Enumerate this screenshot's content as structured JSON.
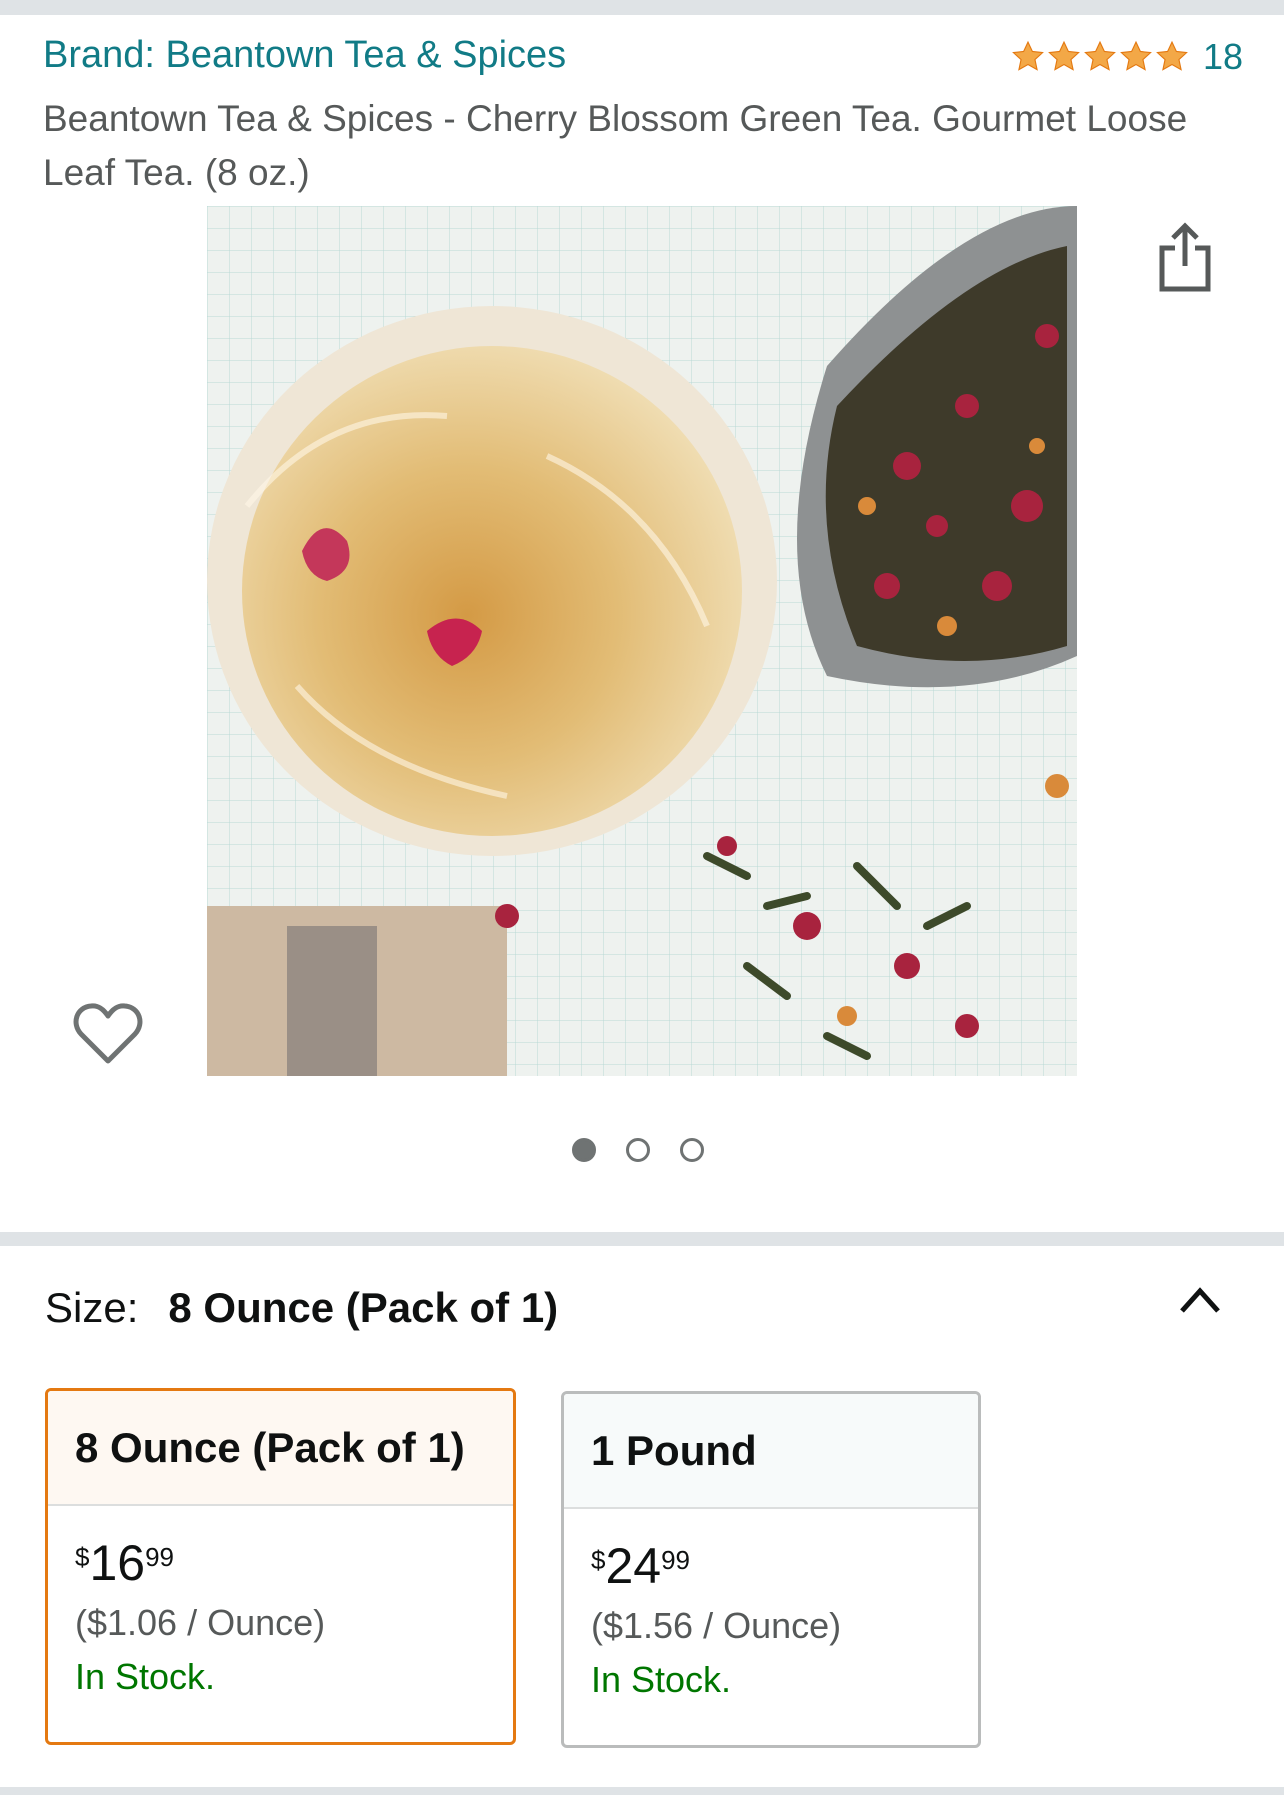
{
  "product": {
    "brand": "Brand: Beantown Tea & Spices",
    "rating_stars": 5,
    "rating_count": "18",
    "title": "Beantown Tea & Spices - Cherry Blossom Green Tea. Gourmet Loose Leaf Tea. (8 oz.)"
  },
  "gallery": {
    "image_count": 3,
    "active_index": 0
  },
  "size": {
    "label": "Size:",
    "selected_value": "8 Ounce (Pack of 1)"
  },
  "options": [
    {
      "name": "8 Ounce (Pack of 1)",
      "currency": "$",
      "price_whole": "16",
      "price_fraction": "99",
      "unit_price": "($1.06 / Ounce)",
      "availability": "In Stock."
    },
    {
      "name": "1 Pound",
      "currency": "$",
      "price_whole": "24",
      "price_fraction": "99",
      "unit_price": "($1.56 / Ounce)",
      "availability": "In Stock."
    }
  ],
  "colors": {
    "link_teal": "#117b86",
    "star_orange": "#f3a847",
    "selected_border": "#e47911",
    "in_stock_green": "#007600"
  },
  "icons": [
    "star-icon",
    "share-icon",
    "heart-icon",
    "chevron-up-icon"
  ]
}
